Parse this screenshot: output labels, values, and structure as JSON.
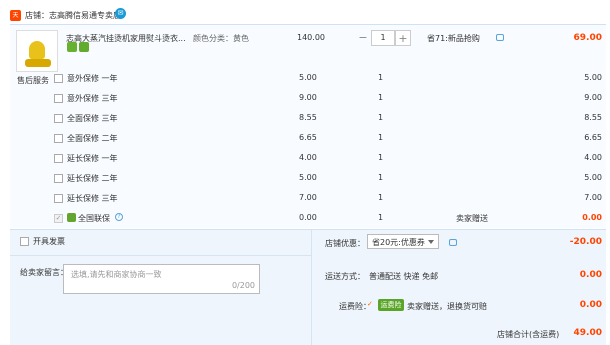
{
  "shop": {
    "icon_text": "天猫",
    "name": "店铺：志高腾信易通专卖店",
    "wangwang_icon": "wangwang-chat-icon"
  },
  "product": {
    "title": "志高大蒸汽挂烫机家用熨斗烫衣...",
    "attributes": "颜色分类：黄色",
    "badge_1": "7",
    "badge_2": "✓",
    "price": "140.00",
    "quantity": "1",
    "qty_minus": "−",
    "qty_plus": "+",
    "promotion": "省71:新品抢购",
    "total": "69.00"
  },
  "services": {
    "label": "售后服务",
    "rows": [
      {
        "name": "意外保修 一年",
        "price": "5.00",
        "qty": "1",
        "total": "5.00"
      },
      {
        "name": "意外保修 三年",
        "price": "9.00",
        "qty": "1",
        "total": "9.00"
      },
      {
        "name": "全面保修 三年",
        "price": "8.55",
        "qty": "1",
        "total": "8.55"
      },
      {
        "name": "全面保修 二年",
        "price": "6.65",
        "qty": "1",
        "total": "6.65"
      },
      {
        "name": "延长保修 一年",
        "price": "4.00",
        "qty": "1",
        "total": "4.00"
      },
      {
        "name": "延长保修 二年",
        "price": "5.00",
        "qty": "1",
        "total": "5.00"
      },
      {
        "name": "延长保修 三年",
        "price": "7.00",
        "qty": "1",
        "total": "7.00"
      }
    ],
    "last": {
      "check": "✓",
      "name": "全国联保",
      "help": "?",
      "price": "0.00",
      "qty": "1",
      "note": "卖家赠送",
      "total": "0.00"
    }
  },
  "invoice": {
    "label": "开具发票"
  },
  "discount": {
    "label": "店铺优惠：",
    "selected": "省20元:优惠券",
    "value": "-20.00"
  },
  "message": {
    "label": "给卖家留言：",
    "placeholder": "选填,请先和商家协商一致",
    "count": "0/200"
  },
  "shipping": {
    "label": "运送方式：",
    "method": "普通配送 快递 免邮",
    "fee": "0.00"
  },
  "insurance": {
    "label": "运费险：",
    "check": "✓",
    "badge": "运费险",
    "text": "卖家赠送，退换货可赔",
    "value": "0.00"
  },
  "subtotal": {
    "label": "店铺合计(含运费)",
    "value": "49.00"
  }
}
